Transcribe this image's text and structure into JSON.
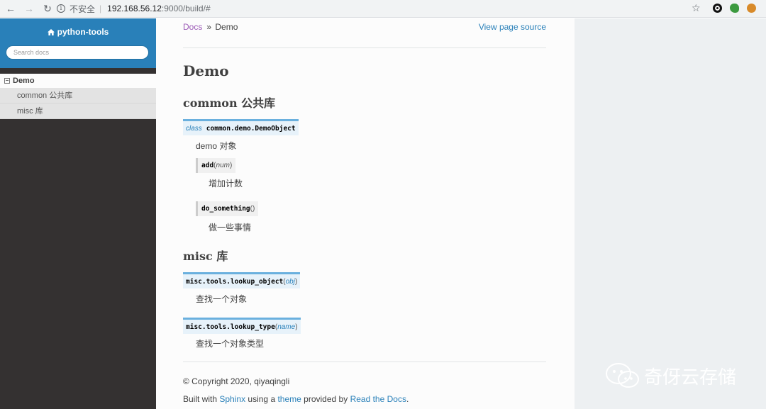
{
  "browser": {
    "security_label": "不安全",
    "separator": "|",
    "url_host": "192.168.56.12",
    "url_rest": ":9000/build/#"
  },
  "sidebar": {
    "project_name": "python-tools",
    "search_placeholder": "Search docs",
    "toc": {
      "top_label": "Demo",
      "items": [
        {
          "label": "common 公共库"
        },
        {
          "label": "misc 库"
        }
      ]
    }
  },
  "breadcrumbs": {
    "root": "Docs",
    "separator": "»",
    "current": "Demo",
    "view_source": "View page source"
  },
  "content": {
    "title": "Demo",
    "sections": [
      {
        "heading": "common 公共库",
        "class_sig": {
          "keyword": "class",
          "name": "common.demo.DemoObject"
        },
        "class_desc": "demo 对象",
        "methods": [
          {
            "name": "add",
            "open": "(",
            "param": "num",
            "close": ")",
            "desc": "增加计数"
          },
          {
            "name": "do_something",
            "open": "(",
            "param": "",
            "close": ")",
            "desc": "做一些事情"
          }
        ]
      },
      {
        "heading": "misc 库",
        "functions": [
          {
            "name": "misc.tools.lookup_object",
            "open": "(",
            "param": "obj",
            "close": ")",
            "desc": "查找一个对象"
          },
          {
            "name": "misc.tools.lookup_type",
            "open": "(",
            "param": "name",
            "close": ")",
            "desc": "查找一个对象类型"
          }
        ]
      }
    ]
  },
  "footer": {
    "copyright": "© Copyright 2020, qiyaqingli",
    "built_with": "Built with",
    "sphinx": "Sphinx",
    "using_a": "using a",
    "theme": "theme",
    "provided_by": "provided by",
    "rtd": "Read the Docs",
    "period": "."
  },
  "watermark": {
    "text": "奇伢云存储"
  },
  "colors": {
    "accent": "#2980b9",
    "sidebar_bg": "#343131",
    "visited_link": "#9b59b6",
    "sig_bg": "#e7f2fa",
    "sig_border": "#6ab0de"
  }
}
